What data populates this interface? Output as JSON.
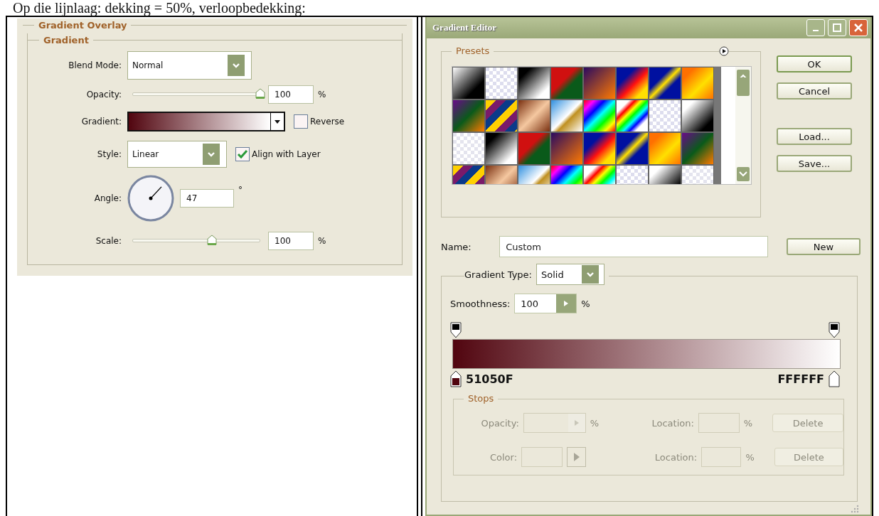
{
  "caption": "Op die lijnlaag: dekking = 50%, verloopbedekking:",
  "layer_style": {
    "title": "Gradient Overlay",
    "group": "Gradient",
    "blend_mode": {
      "label": "Blend Mode:",
      "value": "Normal"
    },
    "opacity": {
      "label": "Opacity:",
      "level": 1,
      "value": "100",
      "unit": "%"
    },
    "gradient": {
      "label": "Gradient:",
      "reverse": {
        "label": "Reverse",
        "checked": false
      }
    },
    "style": {
      "label": "Style:",
      "value": "Linear",
      "align": {
        "label": "Align with Layer",
        "checked": true
      }
    },
    "angle": {
      "label": "Angle:",
      "value": "47",
      "unit": "°"
    },
    "scale": {
      "label": "Scale:",
      "level": 0.62,
      "value": "100",
      "unit": "%"
    }
  },
  "gradient_editor": {
    "title": "Gradient Editor",
    "presets_label": "Presets",
    "buttons": [
      "OK",
      "Cancel",
      "Load...",
      "Save..."
    ],
    "name": {
      "label": "Name:",
      "value": "Custom",
      "button": "New"
    },
    "gradient_type": {
      "label": "Gradient Type:",
      "value": "Solid"
    },
    "smoothness": {
      "label": "Smoothness:",
      "value": "100",
      "unit": "%"
    },
    "color_stops": [
      {
        "label": "51050F",
        "color": "#51050f"
      },
      {
        "label": "FFFFFF",
        "color": "#ffffff"
      }
    ],
    "stops": {
      "title": "Stops",
      "disabled": true,
      "rows": [
        {
          "kind": "opacity",
          "label": "Opacity:",
          "unit": "%",
          "location_label": "Location:",
          "location_unit": "%",
          "button": "Delete"
        },
        {
          "kind": "color",
          "label": "Color:",
          "location_label": "Location:",
          "location_unit": "%",
          "button": "Delete"
        }
      ]
    }
  }
}
